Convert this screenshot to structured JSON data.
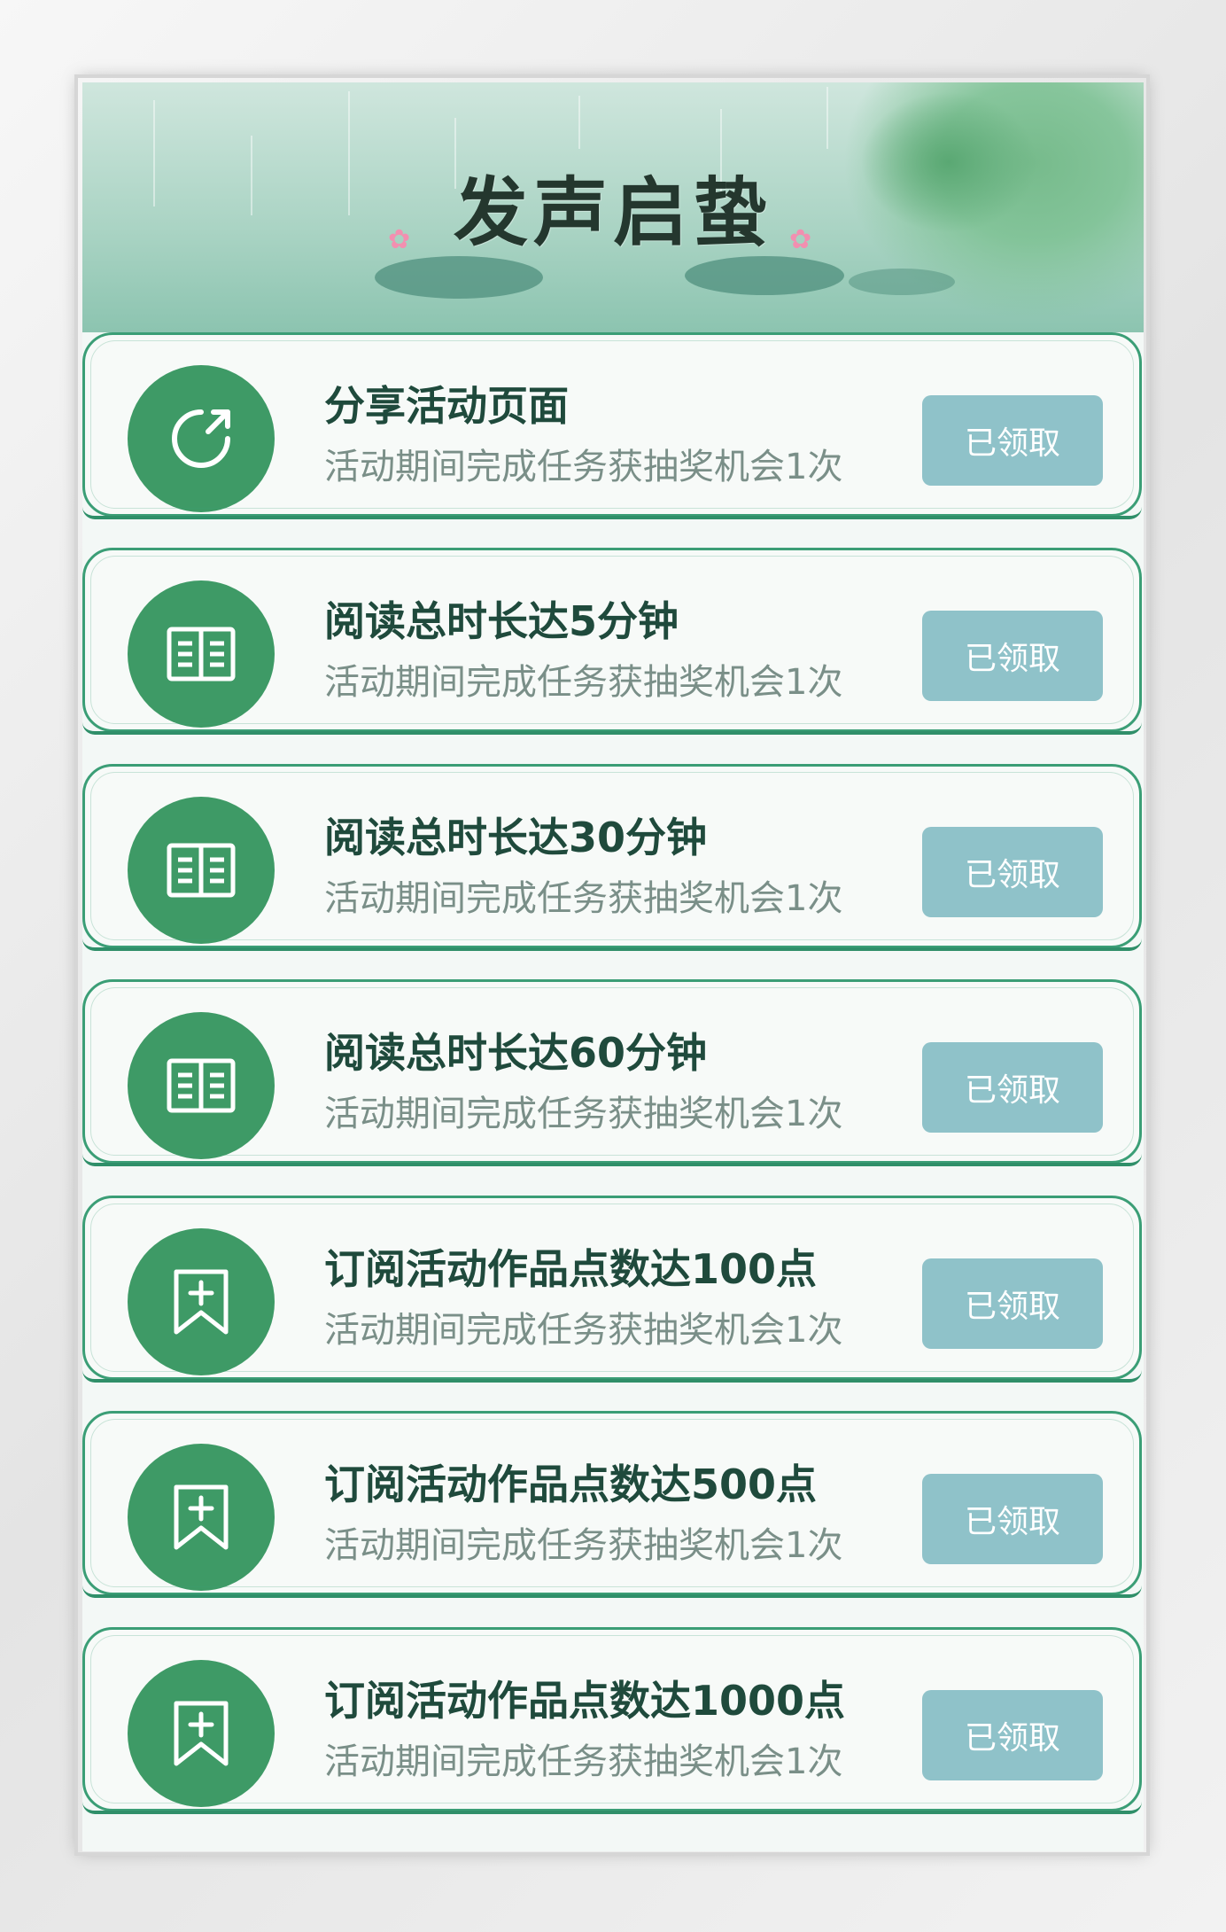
{
  "banner": {
    "title": "发声启蛰"
  },
  "tasks": [
    {
      "title": "分享活动页面",
      "description": "活动期间完成任务获抽奖机会1次",
      "button": "已领取",
      "icon": "share-icon"
    },
    {
      "title": "阅读总时长达5分钟",
      "description": "活动期间完成任务获抽奖机会1次",
      "button": "已领取",
      "icon": "book-icon"
    },
    {
      "title": "阅读总时长达30分钟",
      "description": "活动期间完成任务获抽奖机会1次",
      "button": "已领取",
      "icon": "book-icon"
    },
    {
      "title": "阅读总时长达60分钟",
      "description": "活动期间完成任务获抽奖机会1次",
      "button": "已领取",
      "icon": "book-icon"
    },
    {
      "title": "订阅活动作品点数达100点",
      "description": "活动期间完成任务获抽奖机会1次",
      "button": "已领取",
      "icon": "bookmark-add-icon"
    },
    {
      "title": "订阅活动作品点数达500点",
      "description": "活动期间完成任务获抽奖机会1次",
      "button": "已领取",
      "icon": "bookmark-add-icon"
    },
    {
      "title": "订阅活动作品点数达1000点",
      "description": "活动期间完成任务获抽奖机会1次",
      "button": "已领取",
      "icon": "bookmark-add-icon"
    }
  ],
  "colors": {
    "icon_bg": "#3e9a66",
    "card_border": "#3b9e76",
    "button_bg": "#8fc2c9",
    "title_text": "#1f4a3c",
    "desc_text": "#7a8f88"
  }
}
